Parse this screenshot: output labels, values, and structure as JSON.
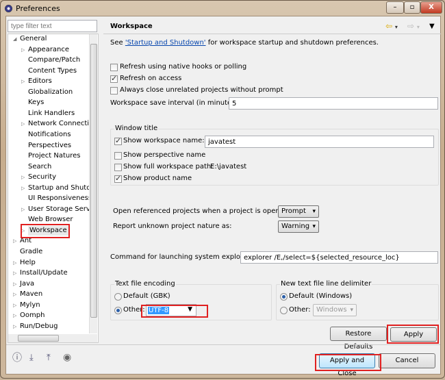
{
  "window": {
    "title": "Preferences",
    "minimize": "–",
    "maximize": "▫",
    "close": "X"
  },
  "sidebar": {
    "filter_placeholder": "type filter text",
    "items": [
      {
        "label": "General",
        "level": 0,
        "expander": "expanded"
      },
      {
        "label": "Appearance",
        "level": 1,
        "expander": "collapsed"
      },
      {
        "label": "Compare/Patch",
        "level": 1,
        "expander": "none"
      },
      {
        "label": "Content Types",
        "level": 1,
        "expander": "none"
      },
      {
        "label": "Editors",
        "level": 1,
        "expander": "collapsed"
      },
      {
        "label": "Globalization",
        "level": 1,
        "expander": "none"
      },
      {
        "label": "Keys",
        "level": 1,
        "expander": "none"
      },
      {
        "label": "Link Handlers",
        "level": 1,
        "expander": "none"
      },
      {
        "label": "Network Connectio",
        "level": 1,
        "expander": "collapsed"
      },
      {
        "label": "Notifications",
        "level": 1,
        "expander": "none"
      },
      {
        "label": "Perspectives",
        "level": 1,
        "expander": "none"
      },
      {
        "label": "Project Natures",
        "level": 1,
        "expander": "none"
      },
      {
        "label": "Search",
        "level": 1,
        "expander": "none"
      },
      {
        "label": "Security",
        "level": 1,
        "expander": "collapsed"
      },
      {
        "label": "Startup and Shutdo",
        "level": 1,
        "expander": "collapsed"
      },
      {
        "label": "UI Responsiveness",
        "level": 1,
        "expander": "none"
      },
      {
        "label": "User Storage Servic",
        "level": 1,
        "expander": "collapsed"
      },
      {
        "label": "Web Browser",
        "level": 1,
        "expander": "none"
      },
      {
        "label": "Workspace",
        "level": 1,
        "expander": "collapsed",
        "selected": true
      },
      {
        "label": "Ant",
        "level": 0,
        "expander": "collapsed"
      },
      {
        "label": "Gradle",
        "level": 0,
        "expander": "none"
      },
      {
        "label": "Help",
        "level": 0,
        "expander": "collapsed"
      },
      {
        "label": "Install/Update",
        "level": 0,
        "expander": "collapsed"
      },
      {
        "label": "Java",
        "level": 0,
        "expander": "collapsed"
      },
      {
        "label": "Maven",
        "level": 0,
        "expander": "collapsed"
      },
      {
        "label": "Mylyn",
        "level": 0,
        "expander": "collapsed"
      },
      {
        "label": "Oomph",
        "level": 0,
        "expander": "collapsed"
      },
      {
        "label": "Run/Debug",
        "level": 0,
        "expander": "collapsed"
      }
    ]
  },
  "page": {
    "title": "Workspace",
    "intro_prefix": "See ",
    "intro_link": "'Startup and Shutdown'",
    "intro_suffix": " for workspace startup and shutdown preferences.",
    "refresh_native": {
      "label": "Refresh using native hooks or polling",
      "checked": false
    },
    "refresh_access": {
      "label": "Refresh on access",
      "checked": true
    },
    "close_unrelated": {
      "label": "Always close unrelated projects without prompt",
      "checked": false
    },
    "save_interval_label": "Workspace save interval (in minutes):",
    "save_interval": "5",
    "window_title": {
      "label": "Window title",
      "show_name": {
        "label": "Show workspace name:",
        "checked": true,
        "value": "javatest"
      },
      "show_perspective": {
        "label": "Show perspective name",
        "checked": false
      },
      "show_path": {
        "label": "Show full workspace path:",
        "checked": false,
        "value": "E:\\javatest"
      },
      "show_product": {
        "label": "Show product name",
        "checked": true
      }
    },
    "open_ref_label": "Open referenced projects when a project is opened:",
    "open_ref_value": "Prompt",
    "unknown_nature_label": "Report unknown project nature as:",
    "unknown_nature_value": "Warning",
    "command_label": "Command for launching system explorer:",
    "command_value": "explorer /E,/select=${selected_resource_loc}",
    "encoding": {
      "label": "Text file encoding",
      "default": "Default (GBK)",
      "other": "Other:",
      "value": "UTF-8",
      "selected": "other"
    },
    "delimiter": {
      "label": "New text file line delimiter",
      "default": "Default (Windows)",
      "other": "Other:",
      "value": "Windows",
      "selected": "default"
    },
    "restore_defaults": "Restore Defaults",
    "apply": "Apply"
  },
  "footer": {
    "apply_close": "Apply and Close",
    "cancel": "Cancel"
  },
  "colors": {
    "highlight": "#e02020",
    "link": "#0645ad",
    "selection": "#3399ff"
  }
}
